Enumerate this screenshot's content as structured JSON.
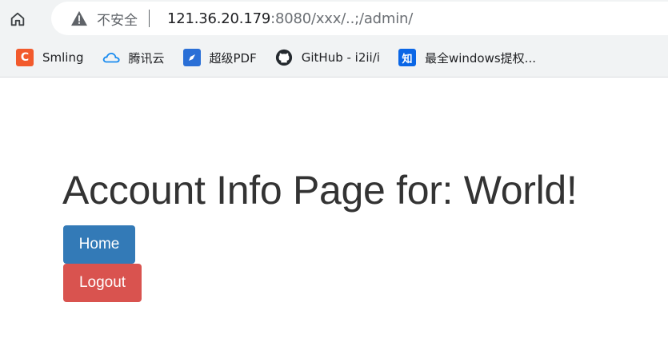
{
  "browser": {
    "security_label": "不安全",
    "url_host": "121.36.20.179",
    "url_rest": ":8080/xxx/..;/admin/",
    "bookmarks": [
      {
        "label": "Smling",
        "icon": "c-logo-icon",
        "color": "#f25a2c"
      },
      {
        "label": "腾讯云",
        "icon": "cloud-icon",
        "color": "#1b8cf0"
      },
      {
        "label": "超级PDF",
        "icon": "rocket-icon",
        "color": "#2a6fd6"
      },
      {
        "label": "GitHub - i2ii/i",
        "icon": "github-icon",
        "color": "#24292e"
      },
      {
        "label": "最全windows提权...",
        "icon": "zhihu-icon",
        "color": "#0a66e6"
      }
    ]
  },
  "page": {
    "title": "Account Info Page for: World!",
    "home_label": "Home",
    "logout_label": "Logout"
  },
  "colors": {
    "home_button": "#337ab7",
    "logout_button": "#d9534f",
    "title_text": "#333333"
  }
}
